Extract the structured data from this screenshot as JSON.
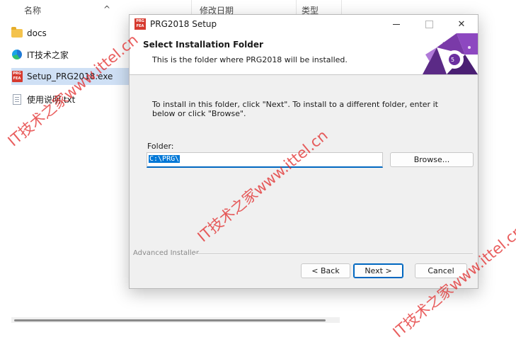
{
  "explorer": {
    "columns": {
      "name": "名称",
      "date": "修改日期",
      "type": "类型"
    },
    "files": [
      {
        "name": "docs",
        "icon": "folder-icon"
      },
      {
        "name": "IT技术之家",
        "icon": "edge-icon"
      },
      {
        "name": "Setup_PRG2018.exe",
        "icon": "exe-icon",
        "selected": true
      },
      {
        "name": "使用说明.txt",
        "icon": "txt-icon"
      }
    ]
  },
  "dialog": {
    "title": "PRG2018 Setup",
    "app_icon_text": "PRG FEA",
    "banner": {
      "title": "Select Installation Folder",
      "subtitle": "This is the folder where PRG2018 will be installed."
    },
    "instructions": "To install in this folder, click \"Next\". To install to a different folder, enter it below or click \"Browse\".",
    "folder_label": "Folder:",
    "folder_value": "C:\\PRG\\",
    "browse_label": "Browse...",
    "branding": "Advanced Installer",
    "back_label": "< Back",
    "next_label": "Next >",
    "cancel_label": "Cancel",
    "accent_color": "#0067c0"
  },
  "watermark": "IT技术之家www.ittel.cn"
}
